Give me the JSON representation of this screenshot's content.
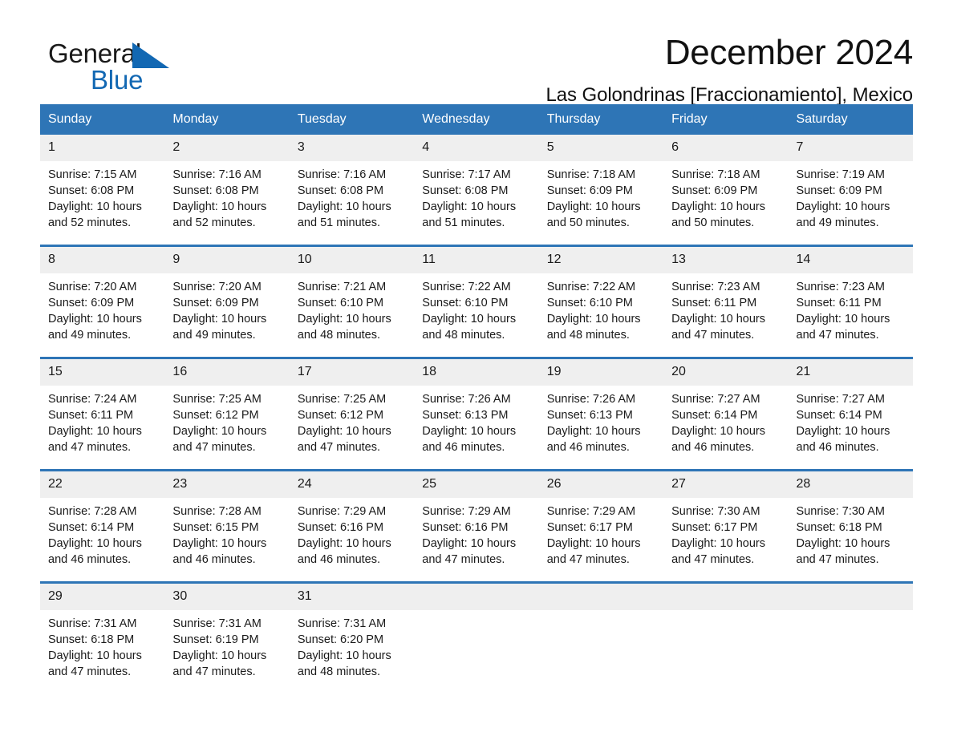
{
  "brand": {
    "name_part1": "General",
    "name_part2": "Blue",
    "accent_color": "#1268b3",
    "triangle_icon": "triangle-icon"
  },
  "header": {
    "month_title": "December 2024",
    "location": "Las Golondrinas [Fraccionamiento], Mexico"
  },
  "calendar": {
    "header_color": "#2e75b6",
    "daynum_band_color": "#efefef",
    "weekdays": [
      "Sunday",
      "Monday",
      "Tuesday",
      "Wednesday",
      "Thursday",
      "Friday",
      "Saturday"
    ],
    "weeks": [
      [
        {
          "day": "1",
          "sunrise": "Sunrise: 7:15 AM",
          "sunset": "Sunset: 6:08 PM",
          "daylight_line1": "Daylight: 10 hours",
          "daylight_line2": "and 52 minutes."
        },
        {
          "day": "2",
          "sunrise": "Sunrise: 7:16 AM",
          "sunset": "Sunset: 6:08 PM",
          "daylight_line1": "Daylight: 10 hours",
          "daylight_line2": "and 52 minutes."
        },
        {
          "day": "3",
          "sunrise": "Sunrise: 7:16 AM",
          "sunset": "Sunset: 6:08 PM",
          "daylight_line1": "Daylight: 10 hours",
          "daylight_line2": "and 51 minutes."
        },
        {
          "day": "4",
          "sunrise": "Sunrise: 7:17 AM",
          "sunset": "Sunset: 6:08 PM",
          "daylight_line1": "Daylight: 10 hours",
          "daylight_line2": "and 51 minutes."
        },
        {
          "day": "5",
          "sunrise": "Sunrise: 7:18 AM",
          "sunset": "Sunset: 6:09 PM",
          "daylight_line1": "Daylight: 10 hours",
          "daylight_line2": "and 50 minutes."
        },
        {
          "day": "6",
          "sunrise": "Sunrise: 7:18 AM",
          "sunset": "Sunset: 6:09 PM",
          "daylight_line1": "Daylight: 10 hours",
          "daylight_line2": "and 50 minutes."
        },
        {
          "day": "7",
          "sunrise": "Sunrise: 7:19 AM",
          "sunset": "Sunset: 6:09 PM",
          "daylight_line1": "Daylight: 10 hours",
          "daylight_line2": "and 49 minutes."
        }
      ],
      [
        {
          "day": "8",
          "sunrise": "Sunrise: 7:20 AM",
          "sunset": "Sunset: 6:09 PM",
          "daylight_line1": "Daylight: 10 hours",
          "daylight_line2": "and 49 minutes."
        },
        {
          "day": "9",
          "sunrise": "Sunrise: 7:20 AM",
          "sunset": "Sunset: 6:09 PM",
          "daylight_line1": "Daylight: 10 hours",
          "daylight_line2": "and 49 minutes."
        },
        {
          "day": "10",
          "sunrise": "Sunrise: 7:21 AM",
          "sunset": "Sunset: 6:10 PM",
          "daylight_line1": "Daylight: 10 hours",
          "daylight_line2": "and 48 minutes."
        },
        {
          "day": "11",
          "sunrise": "Sunrise: 7:22 AM",
          "sunset": "Sunset: 6:10 PM",
          "daylight_line1": "Daylight: 10 hours",
          "daylight_line2": "and 48 minutes."
        },
        {
          "day": "12",
          "sunrise": "Sunrise: 7:22 AM",
          "sunset": "Sunset: 6:10 PM",
          "daylight_line1": "Daylight: 10 hours",
          "daylight_line2": "and 48 minutes."
        },
        {
          "day": "13",
          "sunrise": "Sunrise: 7:23 AM",
          "sunset": "Sunset: 6:11 PM",
          "daylight_line1": "Daylight: 10 hours",
          "daylight_line2": "and 47 minutes."
        },
        {
          "day": "14",
          "sunrise": "Sunrise: 7:23 AM",
          "sunset": "Sunset: 6:11 PM",
          "daylight_line1": "Daylight: 10 hours",
          "daylight_line2": "and 47 minutes."
        }
      ],
      [
        {
          "day": "15",
          "sunrise": "Sunrise: 7:24 AM",
          "sunset": "Sunset: 6:11 PM",
          "daylight_line1": "Daylight: 10 hours",
          "daylight_line2": "and 47 minutes."
        },
        {
          "day": "16",
          "sunrise": "Sunrise: 7:25 AM",
          "sunset": "Sunset: 6:12 PM",
          "daylight_line1": "Daylight: 10 hours",
          "daylight_line2": "and 47 minutes."
        },
        {
          "day": "17",
          "sunrise": "Sunrise: 7:25 AM",
          "sunset": "Sunset: 6:12 PM",
          "daylight_line1": "Daylight: 10 hours",
          "daylight_line2": "and 47 minutes."
        },
        {
          "day": "18",
          "sunrise": "Sunrise: 7:26 AM",
          "sunset": "Sunset: 6:13 PM",
          "daylight_line1": "Daylight: 10 hours",
          "daylight_line2": "and 46 minutes."
        },
        {
          "day": "19",
          "sunrise": "Sunrise: 7:26 AM",
          "sunset": "Sunset: 6:13 PM",
          "daylight_line1": "Daylight: 10 hours",
          "daylight_line2": "and 46 minutes."
        },
        {
          "day": "20",
          "sunrise": "Sunrise: 7:27 AM",
          "sunset": "Sunset: 6:14 PM",
          "daylight_line1": "Daylight: 10 hours",
          "daylight_line2": "and 46 minutes."
        },
        {
          "day": "21",
          "sunrise": "Sunrise: 7:27 AM",
          "sunset": "Sunset: 6:14 PM",
          "daylight_line1": "Daylight: 10 hours",
          "daylight_line2": "and 46 minutes."
        }
      ],
      [
        {
          "day": "22",
          "sunrise": "Sunrise: 7:28 AM",
          "sunset": "Sunset: 6:14 PM",
          "daylight_line1": "Daylight: 10 hours",
          "daylight_line2": "and 46 minutes."
        },
        {
          "day": "23",
          "sunrise": "Sunrise: 7:28 AM",
          "sunset": "Sunset: 6:15 PM",
          "daylight_line1": "Daylight: 10 hours",
          "daylight_line2": "and 46 minutes."
        },
        {
          "day": "24",
          "sunrise": "Sunrise: 7:29 AM",
          "sunset": "Sunset: 6:16 PM",
          "daylight_line1": "Daylight: 10 hours",
          "daylight_line2": "and 46 minutes."
        },
        {
          "day": "25",
          "sunrise": "Sunrise: 7:29 AM",
          "sunset": "Sunset: 6:16 PM",
          "daylight_line1": "Daylight: 10 hours",
          "daylight_line2": "and 47 minutes."
        },
        {
          "day": "26",
          "sunrise": "Sunrise: 7:29 AM",
          "sunset": "Sunset: 6:17 PM",
          "daylight_line1": "Daylight: 10 hours",
          "daylight_line2": "and 47 minutes."
        },
        {
          "day": "27",
          "sunrise": "Sunrise: 7:30 AM",
          "sunset": "Sunset: 6:17 PM",
          "daylight_line1": "Daylight: 10 hours",
          "daylight_line2": "and 47 minutes."
        },
        {
          "day": "28",
          "sunrise": "Sunrise: 7:30 AM",
          "sunset": "Sunset: 6:18 PM",
          "daylight_line1": "Daylight: 10 hours",
          "daylight_line2": "and 47 minutes."
        }
      ],
      [
        {
          "day": "29",
          "sunrise": "Sunrise: 7:31 AM",
          "sunset": "Sunset: 6:18 PM",
          "daylight_line1": "Daylight: 10 hours",
          "daylight_line2": "and 47 minutes."
        },
        {
          "day": "30",
          "sunrise": "Sunrise: 7:31 AM",
          "sunset": "Sunset: 6:19 PM",
          "daylight_line1": "Daylight: 10 hours",
          "daylight_line2": "and 47 minutes."
        },
        {
          "day": "31",
          "sunrise": "Sunrise: 7:31 AM",
          "sunset": "Sunset: 6:20 PM",
          "daylight_line1": "Daylight: 10 hours",
          "daylight_line2": "and 48 minutes."
        },
        {
          "day": "",
          "sunrise": "",
          "sunset": "",
          "daylight_line1": "",
          "daylight_line2": ""
        },
        {
          "day": "",
          "sunrise": "",
          "sunset": "",
          "daylight_line1": "",
          "daylight_line2": ""
        },
        {
          "day": "",
          "sunrise": "",
          "sunset": "",
          "daylight_line1": "",
          "daylight_line2": ""
        },
        {
          "day": "",
          "sunrise": "",
          "sunset": "",
          "daylight_line1": "",
          "daylight_line2": ""
        }
      ]
    ]
  }
}
